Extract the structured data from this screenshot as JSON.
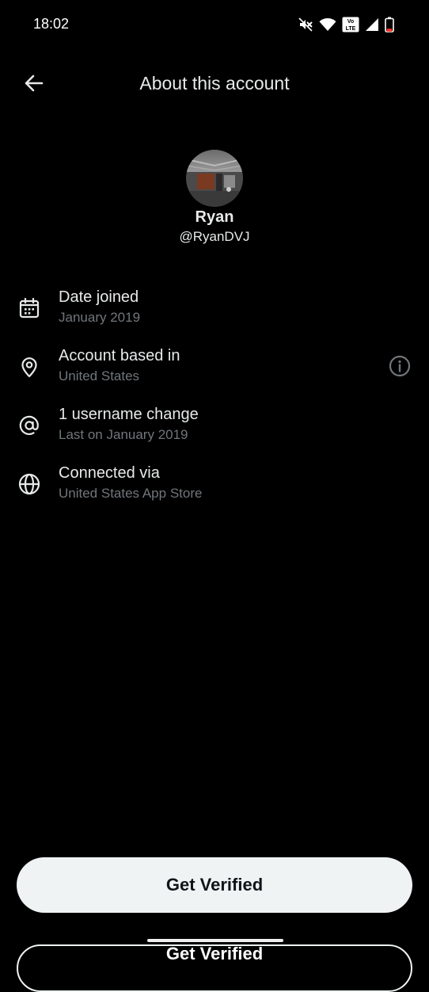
{
  "status_bar": {
    "time": "18:02",
    "volte": [
      "Vo",
      "LTE"
    ],
    "icons": [
      "mute-icon",
      "wifi-icon",
      "volte-icon",
      "signal-icon",
      "battery-icon"
    ],
    "battery_level": 0.25,
    "battery_color": "#ff3b30"
  },
  "header": {
    "title": "About this account",
    "back_icon": "arrow-left-icon"
  },
  "profile": {
    "name": "Ryan",
    "handle": "@RyanDVJ"
  },
  "details": [
    {
      "icon": "calendar-icon",
      "title": "Date joined",
      "subtitle": "January 2019"
    },
    {
      "icon": "location-pin-icon",
      "title": "Account based in",
      "subtitle": "United States",
      "action_icon": "info-icon"
    },
    {
      "icon": "at-sign-icon",
      "title": "1 username change",
      "subtitle": "Last on January 2019"
    },
    {
      "icon": "globe-icon",
      "title": "Connected via",
      "subtitle": "United States App Store"
    }
  ],
  "cta": {
    "label": "Get Verified",
    "duplicate_label": "Get Verified"
  },
  "colors": {
    "background": "#000000",
    "primary_text": "#e7e9ea",
    "secondary_text": "#71767b",
    "button_bg": "#eff3f4"
  }
}
